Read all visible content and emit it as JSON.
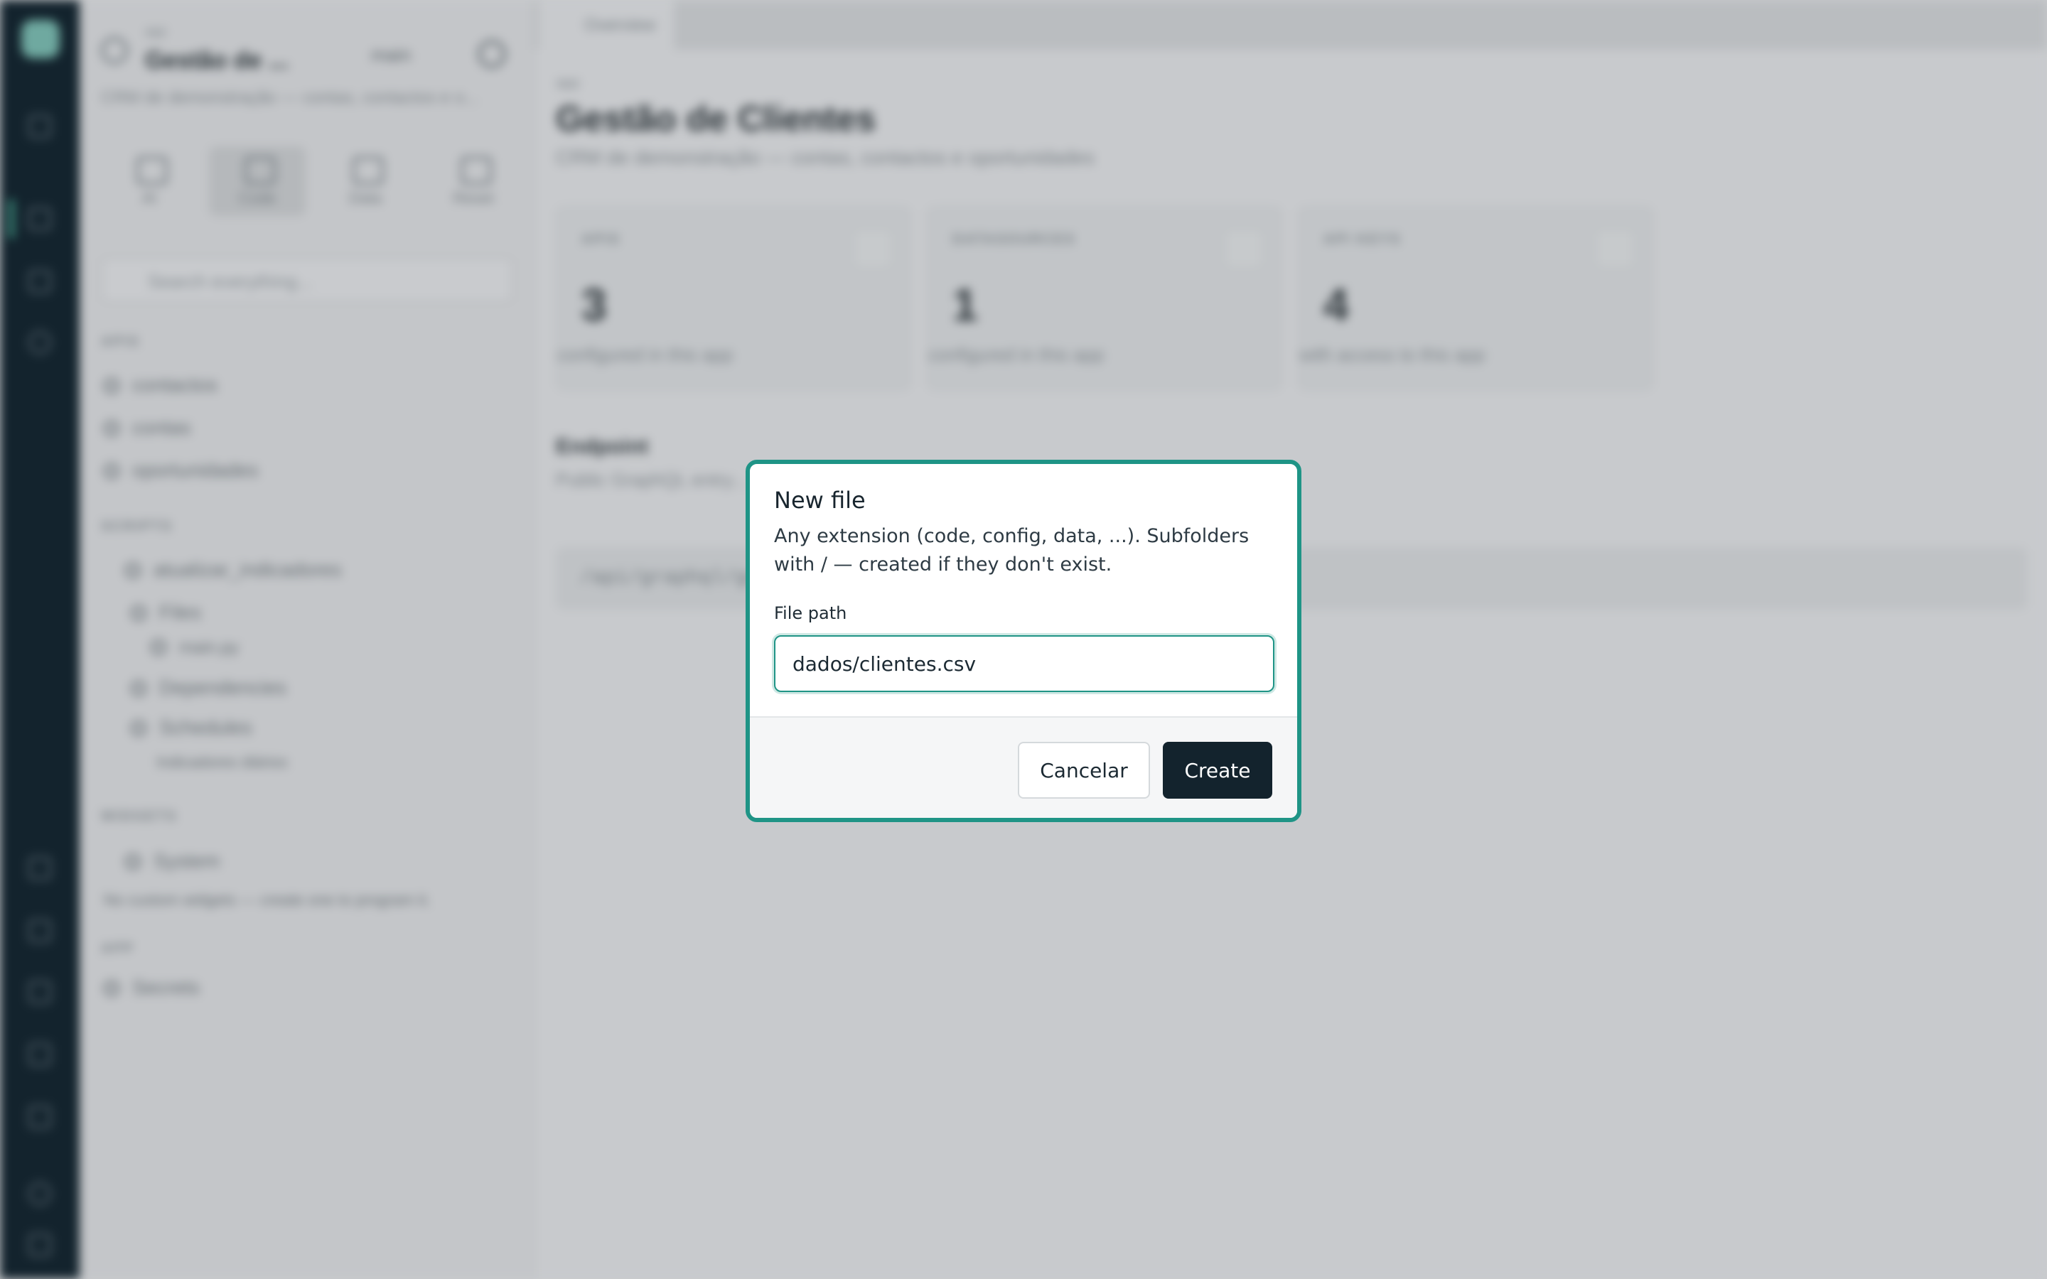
{
  "sidebar": {
    "app_kicker": "app",
    "app_name": "Gestão de ...",
    "branch": "main",
    "app_description": "CRM de demonstração — contas, contactos e o...",
    "modes": [
      "AI",
      "Code",
      "Data",
      "Reset"
    ],
    "search_placeholder": "Search everything...",
    "sections": {
      "apis": "APIS",
      "scripts": "SCRIPTS",
      "widgets": "WIDGETS",
      "app": "APP"
    },
    "apis": [
      "contactos",
      "contas",
      "oportunidades"
    ],
    "scripts": {
      "name": "atualizar_indicadores",
      "files": "Files",
      "file": "main.py",
      "dependencies": "Dependencies",
      "schedules": "Schedules",
      "schedule_item": "Indicadores diários"
    },
    "widgets": {
      "system": "System",
      "empty": "No custom widgets — create one to program it."
    },
    "app_items": [
      "Secrets"
    ]
  },
  "main": {
    "tab": "Overview",
    "kicker": "app",
    "title": "Gestão de Clientes",
    "description": "CRM de demonstração — contas, contactos e oportunidades",
    "cards": [
      {
        "label": "APIS",
        "value": "3",
        "sub": "configured in this app"
      },
      {
        "label": "DATASOURCES",
        "value": "1",
        "sub": "configured in this app"
      },
      {
        "label": "API KEYS",
        "value": "4",
        "sub": "with access to this app"
      }
    ],
    "endpoint_title": "Endpoint",
    "endpoint_sub": "Public GraphQL entry...",
    "endpoint_value": "/api/graphql/gestao..."
  },
  "dialog": {
    "title": "New file",
    "description": "Any extension (code, config, data, ...). Subfolders with / — created if they don't exist.",
    "field_label": "File path",
    "field_value": "dados/clientes.csv",
    "cancel_label": "Cancelar",
    "create_label": "Create",
    "accent_color": "#1f9486",
    "primary_button_color": "#13232d"
  }
}
